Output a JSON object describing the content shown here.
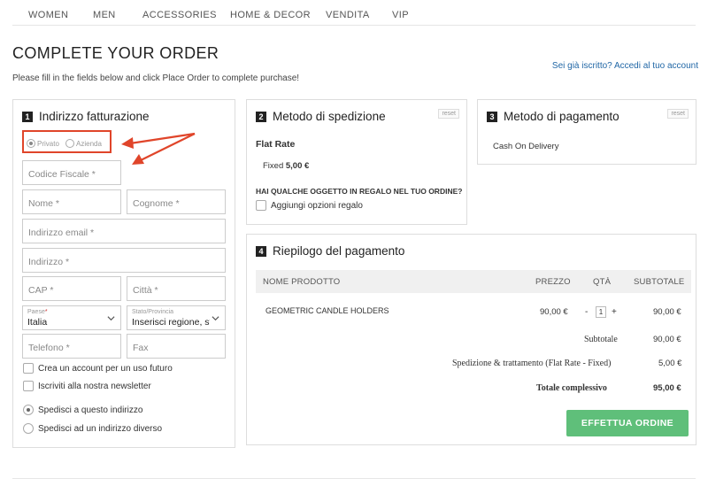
{
  "nav": {
    "items": [
      "WOMEN",
      "MEN",
      "ACCESSORIES",
      "HOME & DECOR",
      "VENDITA",
      "VIP"
    ]
  },
  "page": {
    "title": "COMPLETE YOUR ORDER",
    "subtitle": "Please fill in the fields below and click Place Order to complete purchase!",
    "login_link": "Sei già iscritto? Accedi al tuo account"
  },
  "billing": {
    "number": "1",
    "title": "Indirizzo fatturazione",
    "type_options": [
      "Privato",
      "Azienda"
    ],
    "selected_type": "Privato",
    "fields": {
      "codice_fiscale": "Codice Fiscale *",
      "nome": "Nome *",
      "cognome": "Cognome *",
      "email": "Indirizzo email *",
      "indirizzo": "Indirizzo *",
      "cap": "CAP *",
      "citta": "Città *",
      "paese_label": "Paese",
      "paese_required": "*",
      "paese_value": "Italia",
      "stato_label": "Stato/Provincia",
      "stato_value": "Inserisci regione, stato o provincia",
      "telefono": "Telefono *",
      "fax": "Fax"
    },
    "create_account": "Crea un account per un uso futuro",
    "newsletter": "Iscriviti alla nostra newsletter",
    "ship_same": "Spedisci a questo indirizzo",
    "ship_different": "Spedisci ad un indirizzo diverso"
  },
  "shipping": {
    "number": "2",
    "title": "Metodo di spedizione",
    "reset": "reset",
    "method": "Flat Rate",
    "rate_label": "Fixed",
    "rate_price": "5,00 €",
    "gift_question": "HAI QUALCHE OGGETTO IN REGALO NEL TUO ORDINE?",
    "gift_option": "Aggiungi opzioni regalo"
  },
  "payment": {
    "number": "3",
    "title": "Metodo di pagamento",
    "reset": "reset",
    "method": "Cash On Delivery"
  },
  "summary": {
    "number": "4",
    "title": "Riepilogo del pagamento",
    "columns": [
      "NOME PRODOTTO",
      "PREZZO",
      "QTÀ",
      "SUBTOTALE"
    ],
    "items": [
      {
        "name": "GEOMETRIC CANDLE HOLDERS",
        "price": "90,00 €",
        "qty": "1",
        "subtotal": "90,00 €"
      }
    ],
    "qty_minus": "-",
    "qty_plus": "+",
    "subtotal_label": "Subtotale",
    "subtotal_value": "90,00 €",
    "shipping_label": "Spedizione & trattamento (Flat Rate - Fixed)",
    "shipping_value": "5,00 €",
    "total_label": "Totale complessivo",
    "total_value": "95,00 €",
    "place_order": "EFFETTUA ORDINE"
  },
  "colors": {
    "annotation": "#e0452a",
    "order_button": "#5fbf7a",
    "link": "#2167a6"
  }
}
